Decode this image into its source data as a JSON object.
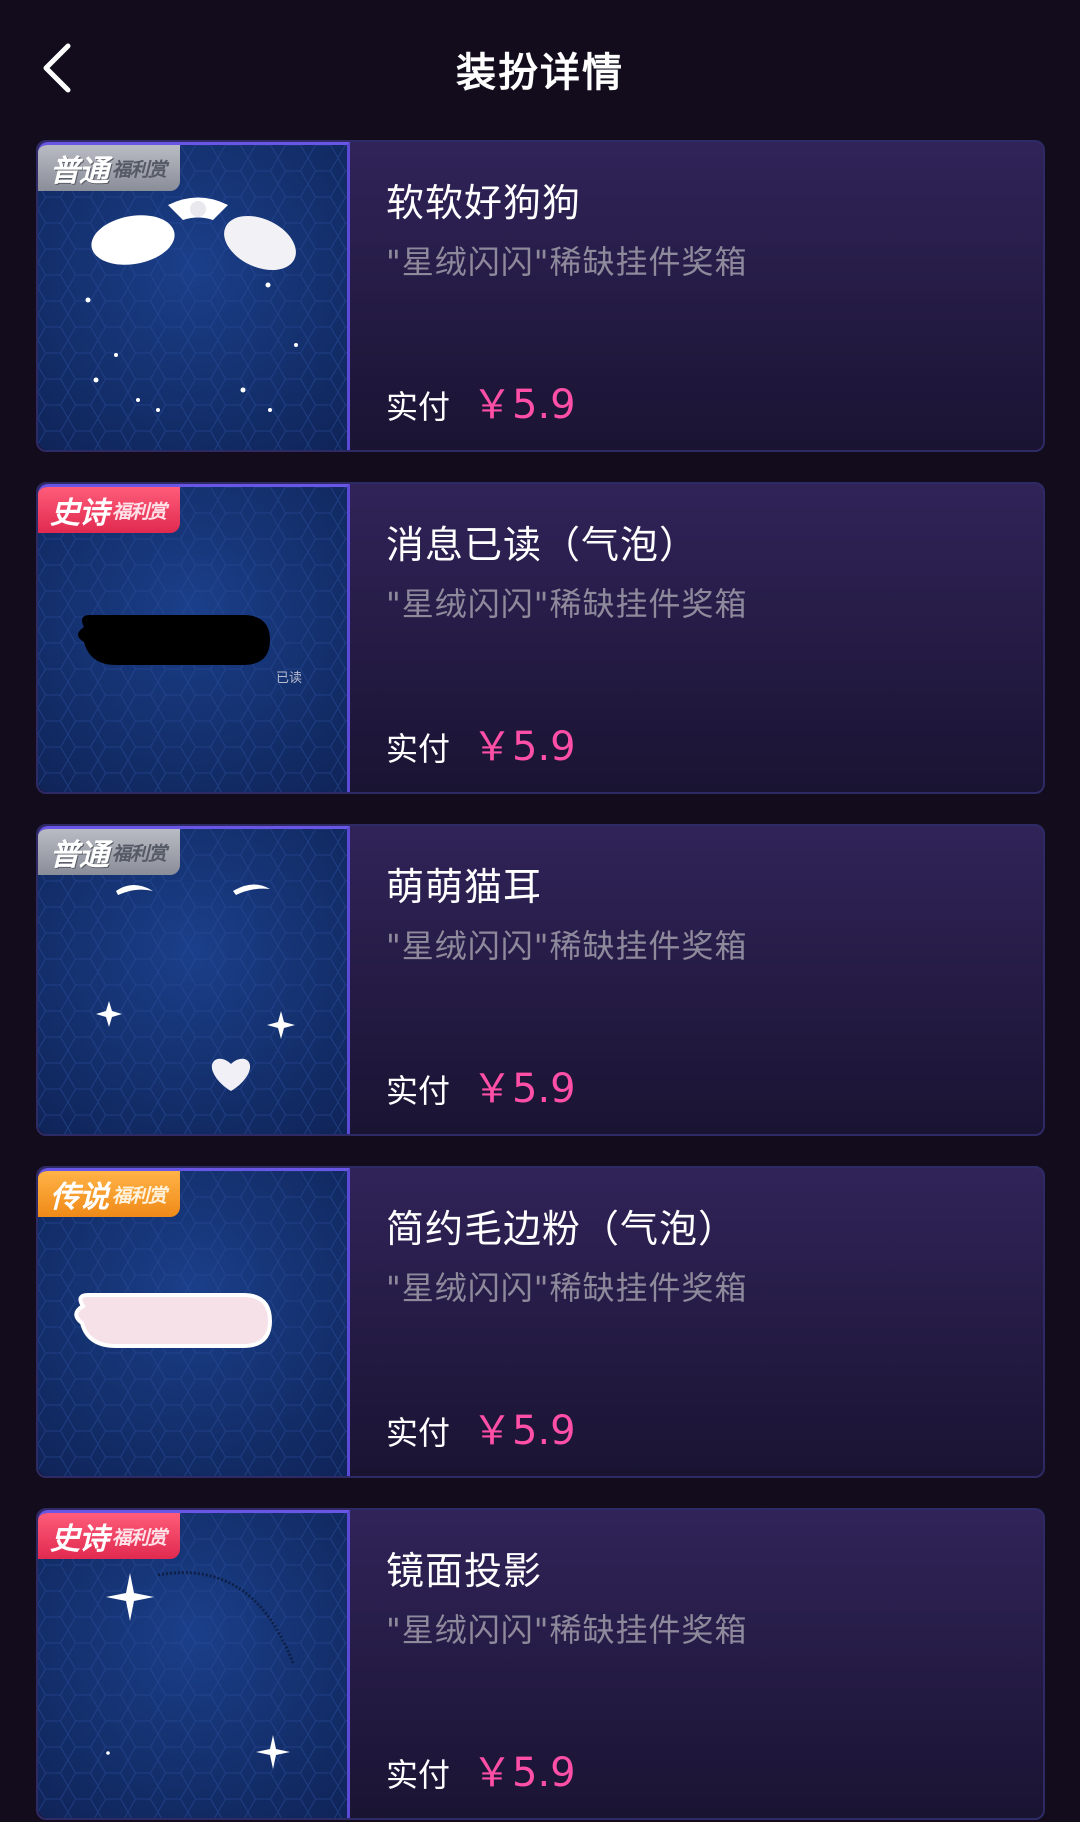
{
  "header": {
    "title": "装扮详情",
    "back_icon": "chevron-left-icon"
  },
  "items": [
    {
      "badge_main": "普通",
      "badge_sub": "福利赏",
      "badge_color": "gray",
      "name": "软软好狗狗",
      "source": "\"星绒闪闪\"稀缺挂件奖箱",
      "price_label": "实付",
      "price": "￥5.9",
      "preview": "dog-ears-preview"
    },
    {
      "badge_main": "史诗",
      "badge_sub": "福利赏",
      "badge_color": "red",
      "name": "消息已读（气泡）",
      "source": "\"星绒闪闪\"稀缺挂件奖箱",
      "price_label": "实付",
      "price": "￥5.9",
      "preview": "black-bubble-preview",
      "preview_text": "已读"
    },
    {
      "badge_main": "普通",
      "badge_sub": "福利赏",
      "badge_color": "gray",
      "name": "萌萌猫耳",
      "source": "\"星绒闪闪\"稀缺挂件奖箱",
      "price_label": "实付",
      "price": "￥5.9",
      "preview": "cat-ears-preview"
    },
    {
      "badge_main": "传说",
      "badge_sub": "福利赏",
      "badge_color": "orange",
      "name": "简约毛边粉（气泡）",
      "source": "\"星绒闪闪\"稀缺挂件奖箱",
      "price_label": "实付",
      "price": "￥5.9",
      "preview": "pink-bubble-preview"
    },
    {
      "badge_main": "史诗",
      "badge_sub": "福利赏",
      "badge_color": "red",
      "name": "镜面投影",
      "source": "\"星绒闪闪\"稀缺挂件奖箱",
      "price_label": "实付",
      "price": "￥5.9",
      "preview": "mirror-sparkle-preview"
    }
  ],
  "colors": {
    "background": "#120c1c",
    "price": "#ff4fa6",
    "source_text": "#8e8a9c"
  }
}
